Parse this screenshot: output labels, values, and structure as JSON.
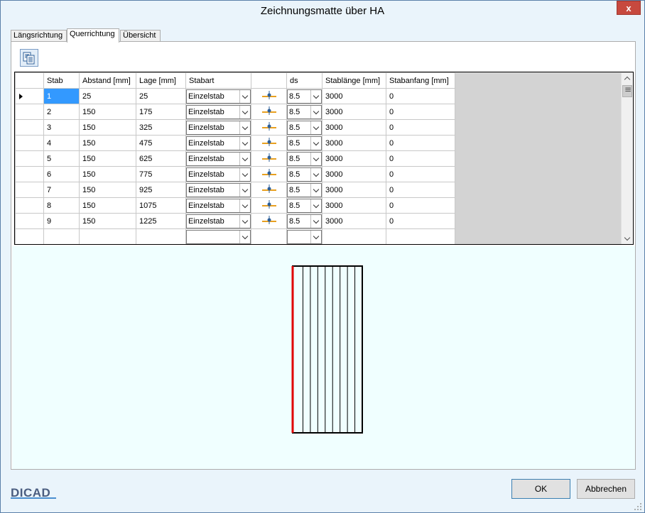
{
  "window": {
    "title": "Zeichnungsmatte über HA",
    "close_label": "x"
  },
  "tabs": [
    {
      "label": "Längsrichtung",
      "active": false
    },
    {
      "label": "Querrichtung",
      "active": true
    },
    {
      "label": "Übersicht",
      "active": false
    }
  ],
  "toolbar": {
    "copy_icon": "copy-icon"
  },
  "grid": {
    "columns": [
      "",
      "Stab",
      "Abstand [mm]",
      "Lage [mm]",
      "Stabart",
      "",
      "ds",
      "Stablänge [mm]",
      "Stabanfang [mm]"
    ],
    "rows": [
      {
        "stab": "1",
        "abstand": "25",
        "lage": "25",
        "stabart": "Einzelstab",
        "ds": "8.5",
        "stablaenge": "3000",
        "stabanfang": "0"
      },
      {
        "stab": "2",
        "abstand": "150",
        "lage": "175",
        "stabart": "Einzelstab",
        "ds": "8.5",
        "stablaenge": "3000",
        "stabanfang": "0"
      },
      {
        "stab": "3",
        "abstand": "150",
        "lage": "325",
        "stabart": "Einzelstab",
        "ds": "8.5",
        "stablaenge": "3000",
        "stabanfang": "0"
      },
      {
        "stab": "4",
        "abstand": "150",
        "lage": "475",
        "stabart": "Einzelstab",
        "ds": "8.5",
        "stablaenge": "3000",
        "stabanfang": "0"
      },
      {
        "stab": "5",
        "abstand": "150",
        "lage": "625",
        "stabart": "Einzelstab",
        "ds": "8.5",
        "stablaenge": "3000",
        "stabanfang": "0"
      },
      {
        "stab": "6",
        "abstand": "150",
        "lage": "775",
        "stabart": "Einzelstab",
        "ds": "8.5",
        "stablaenge": "3000",
        "stabanfang": "0"
      },
      {
        "stab": "7",
        "abstand": "150",
        "lage": "925",
        "stabart": "Einzelstab",
        "ds": "8.5",
        "stablaenge": "3000",
        "stabanfang": "0"
      },
      {
        "stab": "8",
        "abstand": "150",
        "lage": "1075",
        "stabart": "Einzelstab",
        "ds": "8.5",
        "stablaenge": "3000",
        "stabanfang": "0"
      },
      {
        "stab": "9",
        "abstand": "150",
        "lage": "1225",
        "stabart": "Einzelstab",
        "ds": "8.5",
        "stablaenge": "3000",
        "stabanfang": "0"
      }
    ],
    "selected_row": 0
  },
  "preview": {
    "bar_count": 9,
    "highlight_color": "#e00000",
    "background": "#f0ffff"
  },
  "footer": {
    "ok_label": "OK",
    "cancel_label": "Abbrechen",
    "logo_text": "DICAD"
  }
}
